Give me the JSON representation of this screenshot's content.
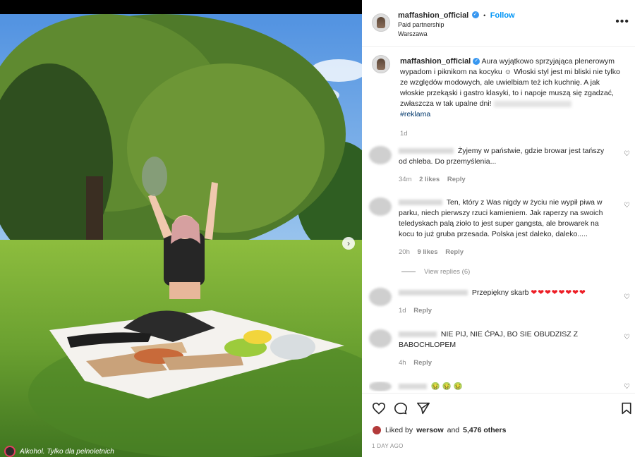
{
  "post": {
    "username": "maffashion_official",
    "follow_label": "Follow",
    "partnership": "Paid partnership",
    "location": "Warszawa",
    "more_label": "•••"
  },
  "caption": {
    "username": "maffashion_official",
    "text": "Aura wyjątkowo sprzyjająca plenerowym wypadom i piknikom na kocyku ☺ Włoski styl jest mi bliski nie tylko ze względów modowych, ale uwielbiam też ich kuchnię. A jak włoskie przekąski i gastro klasyki, to i napoje muszą się zgadzać, zwłaszcza w tak upalne dni!",
    "hashtag": "#reklama",
    "time": "1d"
  },
  "comments": [
    {
      "text": "Żyjemy w państwie, gdzie browar jest tańszy od chleba. Do przemyślenia...",
      "time": "34m",
      "likes": "2 likes",
      "reply": "Reply"
    },
    {
      "text": "Ten, który z Was nigdy w życiu nie wypił piwa w parku, niech pierwszy rzuci kamieniem. Jak raperzy na swoich teledyskach palą zioło to jest super gangsta, ale browarek na kocu to już gruba przesada. Polska jest daleko, daleko.....",
      "time": "20h",
      "likes": "9 likes",
      "reply": "Reply"
    },
    {
      "text": "Przepiękny skarb",
      "emoji": "❤❤❤❤❤❤❤❤",
      "time": "1d",
      "reply": "Reply"
    },
    {
      "text": "NIE PIJ, NIE ĆPAJ, BO SIE OBUDZISZ Z BABOCHLOPEM",
      "time": "4h",
      "reply": "Reply"
    }
  ],
  "view_replies": "View replies (6)",
  "actions": {
    "liked_by_prefix": "Liked by",
    "liked_by_user": "wersow",
    "and": "and",
    "others": "5,476 others",
    "date": "1 DAY AGO"
  },
  "photo_caption": "Alkohol. Tylko dla pełnoletnich",
  "colors": {
    "link_blue": "#0095f6",
    "hashtag_blue": "#00376b",
    "muted": "#8e8e8e",
    "heart_red": "#ed1c24"
  }
}
